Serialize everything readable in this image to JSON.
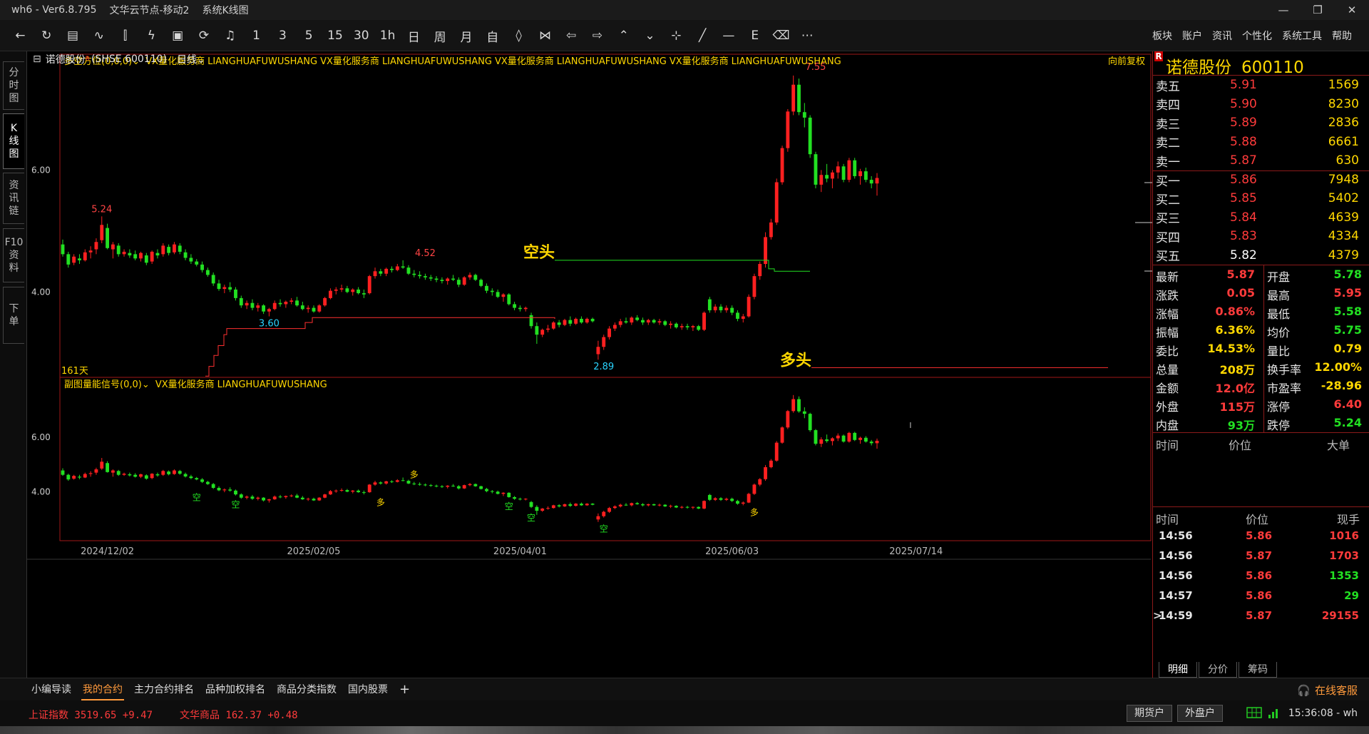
{
  "window": {
    "app": "wh6",
    "version": "Ver6.8.795",
    "server": "文华云节点-移动2",
    "view": "系统K线图",
    "separator": "-"
  },
  "toolbar": {
    "tools": [
      {
        "name": "back-arrow-icon",
        "glyph": "←"
      },
      {
        "name": "refresh-icon",
        "glyph": "↻"
      },
      {
        "name": "quote-list-icon",
        "glyph": "▤"
      },
      {
        "name": "line-chart-icon",
        "glyph": "∿"
      },
      {
        "name": "kline-icon",
        "glyph": "⫿"
      },
      {
        "name": "lightning-icon",
        "glyph": "ϟ"
      },
      {
        "name": "indicator-icon",
        "glyph": "▣"
      },
      {
        "name": "flash-icon",
        "glyph": "⟳"
      },
      {
        "name": "bell-icon",
        "glyph": "♫"
      },
      {
        "name": "period-1m",
        "glyph": "1"
      },
      {
        "name": "period-3m",
        "glyph": "3"
      },
      {
        "name": "period-5m",
        "glyph": "5"
      },
      {
        "name": "period-15m",
        "glyph": "15"
      },
      {
        "name": "period-30m",
        "glyph": "30"
      },
      {
        "name": "period-1h",
        "glyph": "1h"
      },
      {
        "name": "period-day",
        "glyph": "日"
      },
      {
        "name": "period-week",
        "glyph": "周"
      },
      {
        "name": "period-month",
        "glyph": "月"
      },
      {
        "name": "period-custom",
        "glyph": "自"
      },
      {
        "name": "zoom-in-icon",
        "glyph": "◊"
      },
      {
        "name": "zoom-out-icon",
        "glyph": "⋈"
      },
      {
        "name": "move-left-icon",
        "glyph": "⇦"
      },
      {
        "name": "move-right-icon",
        "glyph": "⇨"
      },
      {
        "name": "expand-up-icon",
        "glyph": "⌃"
      },
      {
        "name": "expand-down-icon",
        "glyph": "⌄"
      },
      {
        "name": "crosshair-icon",
        "glyph": "⊹"
      },
      {
        "name": "draw-line-icon",
        "glyph": "╱"
      },
      {
        "name": "horizontal-line-icon",
        "glyph": "—"
      },
      {
        "name": "text-icon",
        "glyph": "E"
      },
      {
        "name": "eraser-icon",
        "glyph": "⌫"
      },
      {
        "name": "more-icon",
        "glyph": "⋯"
      }
    ],
    "menus": [
      "板块",
      "账户",
      "资讯",
      "个性化",
      "系统工具",
      "帮助"
    ]
  },
  "left_tabs": [
    {
      "label": "分\n时\n图",
      "active": false
    },
    {
      "label": "K\n线\n图",
      "active": true
    },
    {
      "label": "资\n讯\n链",
      "active": false
    },
    {
      "label": "F10\n资\n料",
      "active": false
    },
    {
      "label": "下\n单",
      "active": false
    }
  ],
  "stock": {
    "name": "诺德股份",
    "name_superscript": "R",
    "code_label": "(SHSE 600110)",
    "period": "日线",
    "code": "600110"
  },
  "main_chart": {
    "indicator_label": "多空方位(0,0,0)",
    "vendor_items": [
      "VX量化服务商",
      "LIANGHUAFUWUSHANG",
      "VX量化服务商",
      "LIANGHUAFUWUSHANG",
      "VX量化服务商",
      "LIANGHUAFUWUSHANG",
      "VX量化服务商",
      "LIANGHUAFUWUSHANG"
    ],
    "adjust_label": "向前复权",
    "days_label": "161天",
    "annotations": [
      {
        "text": "5.24",
        "color": "#ff4444"
      },
      {
        "text": "4.52",
        "color": "#ff4444"
      },
      {
        "text": "7.55",
        "color": "#ff4444"
      },
      {
        "text": "3.60",
        "color": "#2ad4ff"
      },
      {
        "text": "2.89",
        "color": "#2ad4ff"
      }
    ],
    "bear_label": "空头",
    "bull_label": "多头",
    "ylabels": [
      "6.00",
      "4.00"
    ]
  },
  "sub_chart": {
    "indicator_label": "副图量能信号(0,0)",
    "vendor_items": [
      "VX量化服务商",
      "LIANGHUAFUWUSHANG"
    ],
    "ylabels": [
      "6.00",
      "4.00"
    ],
    "signals": [
      {
        "text": "空",
        "color": "#22e022"
      },
      {
        "text": "空",
        "color": "#22e022"
      },
      {
        "text": "多",
        "color": "#ffd700"
      },
      {
        "text": "多",
        "color": "#ffd700"
      },
      {
        "text": "空",
        "color": "#22e022"
      },
      {
        "text": "空",
        "color": "#22e022"
      },
      {
        "text": "空",
        "color": "#22e022"
      },
      {
        "text": "多",
        "color": "#ffd700"
      }
    ]
  },
  "x_dates": [
    "2024/12/02",
    "2025/02/05",
    "2025/04/01",
    "2025/06/03",
    "2025/07/14"
  ],
  "chart_data": {
    "type": "candlestick",
    "title": "",
    "price_range": [
      2.6,
      7.9
    ],
    "candles": [
      [
        4.78,
        4.86,
        4.58,
        4.62
      ],
      [
        4.62,
        4.66,
        4.4,
        4.45
      ],
      [
        4.48,
        4.62,
        4.44,
        4.58
      ],
      [
        4.55,
        4.62,
        4.46,
        4.52
      ],
      [
        4.52,
        4.7,
        4.5,
        4.65
      ],
      [
        4.65,
        4.75,
        4.55,
        4.68
      ],
      [
        4.7,
        4.88,
        4.62,
        4.82
      ],
      [
        4.85,
        5.24,
        4.8,
        5.1
      ],
      [
        5.05,
        5.12,
        4.7,
        4.72
      ],
      [
        4.7,
        4.82,
        4.55,
        4.78
      ],
      [
        4.76,
        4.8,
        4.58,
        4.62
      ],
      [
        4.62,
        4.7,
        4.58,
        4.66
      ],
      [
        4.64,
        4.7,
        4.56,
        4.6
      ],
      [
        4.62,
        4.68,
        4.52,
        4.55
      ],
      [
        4.55,
        4.66,
        4.5,
        4.64
      ],
      [
        4.6,
        4.64,
        4.44,
        4.48
      ],
      [
        4.5,
        4.68,
        4.46,
        4.66
      ],
      [
        4.64,
        4.7,
        4.55,
        4.6
      ],
      [
        4.62,
        4.8,
        4.58,
        4.76
      ],
      [
        4.74,
        4.78,
        4.6,
        4.64
      ],
      [
        4.65,
        4.82,
        4.62,
        4.78
      ],
      [
        4.76,
        4.8,
        4.62,
        4.66
      ],
      [
        4.65,
        4.7,
        4.52,
        4.56
      ],
      [
        4.56,
        4.62,
        4.46,
        4.5
      ],
      [
        4.5,
        4.54,
        4.42,
        4.45
      ],
      [
        4.45,
        4.5,
        4.32,
        4.36
      ],
      [
        4.36,
        4.4,
        4.25,
        4.28
      ],
      [
        4.28,
        4.32,
        4.1,
        4.14
      ],
      [
        4.14,
        4.2,
        4.02,
        4.05
      ],
      [
        4.05,
        4.12,
        3.98,
        4.08
      ],
      [
        4.08,
        4.16,
        4.0,
        4.04
      ],
      [
        4.04,
        4.08,
        3.86,
        3.9
      ],
      [
        3.9,
        3.94,
        3.74,
        3.78
      ],
      [
        3.78,
        3.86,
        3.72,
        3.82
      ],
      [
        3.82,
        3.88,
        3.7,
        3.74
      ],
      [
        3.74,
        3.82,
        3.68,
        3.78
      ],
      [
        3.78,
        3.8,
        3.64,
        3.68
      ],
      [
        3.68,
        3.74,
        3.6,
        3.72
      ],
      [
        3.72,
        3.86,
        3.7,
        3.82
      ],
      [
        3.82,
        3.88,
        3.76,
        3.8
      ],
      [
        3.8,
        3.86,
        3.74,
        3.84
      ],
      [
        3.84,
        3.9,
        3.8,
        3.86
      ],
      [
        3.86,
        3.92,
        3.76,
        3.78
      ],
      [
        3.78,
        3.84,
        3.7,
        3.72
      ],
      [
        3.72,
        3.78,
        3.66,
        3.74
      ],
      [
        3.74,
        3.78,
        3.66,
        3.68
      ],
      [
        3.68,
        3.8,
        3.66,
        3.78
      ],
      [
        3.78,
        3.92,
        3.76,
        3.9
      ],
      [
        3.9,
        4.06,
        3.88,
        4.02
      ],
      [
        4.02,
        4.08,
        3.96,
        4.04
      ],
      [
        4.04,
        4.12,
        4.0,
        4.06
      ],
      [
        4.06,
        4.1,
        3.98,
        4.0
      ],
      [
        4.0,
        4.06,
        3.94,
        4.04
      ],
      [
        4.04,
        4.08,
        3.96,
        3.98
      ],
      [
        3.98,
        4.04,
        3.9,
        3.96
      ],
      [
        3.98,
        4.28,
        3.96,
        4.26
      ],
      [
        4.26,
        4.4,
        4.22,
        4.34
      ],
      [
        4.34,
        4.38,
        4.26,
        4.3
      ],
      [
        4.3,
        4.4,
        4.26,
        4.38
      ],
      [
        4.38,
        4.42,
        4.32,
        4.36
      ],
      [
        4.36,
        4.46,
        4.34,
        4.42
      ],
      [
        4.42,
        4.52,
        4.38,
        4.4
      ],
      [
        4.4,
        4.44,
        4.28,
        4.3
      ],
      [
        4.3,
        4.36,
        4.24,
        4.28
      ],
      [
        4.28,
        4.34,
        4.22,
        4.26
      ],
      [
        4.26,
        4.3,
        4.2,
        4.24
      ],
      [
        4.24,
        4.28,
        4.18,
        4.22
      ],
      [
        4.22,
        4.26,
        4.16,
        4.2
      ],
      [
        4.2,
        4.24,
        4.14,
        4.18
      ],
      [
        4.18,
        4.24,
        4.12,
        4.22
      ],
      [
        4.22,
        4.28,
        4.18,
        4.2
      ],
      [
        4.2,
        4.24,
        4.08,
        4.12
      ],
      [
        4.12,
        4.26,
        4.1,
        4.24
      ],
      [
        4.24,
        4.32,
        4.2,
        4.28
      ],
      [
        4.28,
        4.3,
        4.18,
        4.2
      ],
      [
        4.2,
        4.22,
        4.08,
        4.1
      ],
      [
        4.1,
        4.14,
        3.98,
        4.02
      ],
      [
        4.02,
        4.06,
        3.94,
        4.0
      ],
      [
        4.0,
        4.04,
        3.9,
        3.92
      ],
      [
        3.92,
        3.98,
        3.84,
        3.96
      ],
      [
        3.96,
        3.98,
        3.78,
        3.8
      ],
      [
        3.8,
        3.84,
        3.7,
        3.74
      ],
      [
        3.74,
        3.78,
        3.68,
        3.72
      ],
      [
        3.72,
        3.76,
        3.68,
        3.74
      ],
      [
        3.62,
        3.66,
        3.4,
        3.44
      ],
      [
        3.44,
        3.5,
        3.15,
        3.3
      ],
      [
        3.3,
        3.4,
        3.26,
        3.38
      ],
      [
        3.38,
        3.46,
        3.34,
        3.4
      ],
      [
        3.4,
        3.52,
        3.38,
        3.5
      ],
      [
        3.5,
        3.54,
        3.42,
        3.46
      ],
      [
        3.46,
        3.56,
        3.44,
        3.54
      ],
      [
        3.54,
        3.6,
        3.44,
        3.48
      ],
      [
        3.48,
        3.58,
        3.46,
        3.56
      ],
      [
        3.56,
        3.6,
        3.48,
        3.5
      ],
      [
        3.5,
        3.58,
        3.48,
        3.56
      ],
      [
        3.56,
        3.58,
        3.5,
        3.52
      ],
      [
        2.98,
        3.2,
        2.89,
        3.1
      ],
      [
        3.1,
        3.3,
        3.05,
        3.26
      ],
      [
        3.26,
        3.44,
        3.22,
        3.4
      ],
      [
        3.4,
        3.5,
        3.36,
        3.46
      ],
      [
        3.46,
        3.56,
        3.42,
        3.52
      ],
      [
        3.52,
        3.58,
        3.48,
        3.5
      ],
      [
        3.5,
        3.6,
        3.46,
        3.58
      ],
      [
        3.58,
        3.62,
        3.52,
        3.54
      ],
      [
        3.54,
        3.58,
        3.46,
        3.5
      ],
      [
        3.5,
        3.56,
        3.46,
        3.54
      ],
      [
        3.54,
        3.56,
        3.48,
        3.5
      ],
      [
        3.5,
        3.56,
        3.46,
        3.52
      ],
      [
        3.52,
        3.54,
        3.44,
        3.46
      ],
      [
        3.46,
        3.52,
        3.4,
        3.48
      ],
      [
        3.48,
        3.5,
        3.4,
        3.42
      ],
      [
        3.42,
        3.48,
        3.38,
        3.44
      ],
      [
        3.44,
        3.48,
        3.38,
        3.42
      ],
      [
        3.42,
        3.46,
        3.36,
        3.44
      ],
      [
        3.44,
        3.46,
        3.36,
        3.38
      ],
      [
        3.38,
        3.68,
        3.36,
        3.66
      ],
      [
        3.88,
        3.92,
        3.66,
        3.7
      ],
      [
        3.7,
        3.8,
        3.66,
        3.76
      ],
      [
        3.76,
        3.8,
        3.66,
        3.7
      ],
      [
        3.7,
        3.78,
        3.66,
        3.74
      ],
      [
        3.74,
        3.78,
        3.62,
        3.66
      ],
      [
        3.66,
        3.7,
        3.52,
        3.56
      ],
      [
        3.56,
        3.64,
        3.5,
        3.6
      ],
      [
        3.6,
        3.96,
        3.58,
        3.92
      ],
      [
        3.92,
        4.3,
        3.88,
        4.26
      ],
      [
        4.26,
        4.5,
        4.2,
        4.46
      ],
      [
        4.46,
        4.98,
        4.4,
        4.9
      ],
      [
        4.9,
        5.2,
        4.86,
        5.14
      ],
      [
        5.14,
        5.86,
        5.1,
        5.8
      ],
      [
        5.8,
        6.4,
        5.76,
        6.36
      ],
      [
        6.36,
        7.0,
        6.3,
        6.96
      ],
      [
        6.96,
        7.55,
        6.9,
        7.4
      ],
      [
        7.4,
        7.5,
        6.9,
        6.95
      ],
      [
        6.95,
        7.1,
        6.7,
        6.86
      ],
      [
        6.86,
        6.9,
        6.2,
        6.26
      ],
      [
        6.26,
        6.3,
        5.7,
        5.76
      ],
      [
        5.76,
        6.0,
        5.64,
        5.92
      ],
      [
        5.92,
        6.1,
        5.8,
        5.86
      ],
      [
        5.86,
        6.0,
        5.7,
        5.96
      ],
      [
        5.96,
        6.14,
        5.86,
        6.06
      ],
      [
        6.06,
        6.1,
        5.8,
        5.84
      ],
      [
        5.84,
        6.2,
        5.8,
        6.16
      ],
      [
        6.16,
        6.2,
        5.86,
        5.9
      ],
      [
        5.9,
        6.02,
        5.76,
        5.98
      ],
      [
        5.98,
        6.04,
        5.8,
        5.84
      ],
      [
        5.84,
        5.9,
        5.7,
        5.78
      ],
      [
        5.78,
        5.95,
        5.58,
        5.87
      ]
    ],
    "bear_line": {
      "label": "空头",
      "value": 4.52
    },
    "bull_line": {
      "label": "多头",
      "value": 2.76
    }
  },
  "quote_panel": {
    "book": [
      {
        "label": "卖五",
        "price": "5.91",
        "vol": "1569"
      },
      {
        "label": "卖四",
        "price": "5.90",
        "vol": "8230"
      },
      {
        "label": "卖三",
        "price": "5.89",
        "vol": "2836"
      },
      {
        "label": "卖二",
        "price": "5.88",
        "vol": "6661"
      },
      {
        "label": "卖一",
        "price": "5.87",
        "vol": "630"
      },
      {
        "label": "买一",
        "price": "5.86",
        "vol": "7948"
      },
      {
        "label": "买二",
        "price": "5.85",
        "vol": "5402"
      },
      {
        "label": "买三",
        "price": "5.84",
        "vol": "4639"
      },
      {
        "label": "买四",
        "price": "5.83",
        "vol": "4334"
      },
      {
        "label": "买五",
        "price": "5.82",
        "vol": "4379"
      }
    ],
    "stats": [
      {
        "l1": "最新",
        "v1": "5.87",
        "c1": "red",
        "l2": "开盘",
        "v2": "5.78",
        "c2": "green"
      },
      {
        "l1": "涨跌",
        "v1": "0.05",
        "c1": "red",
        "l2": "最高",
        "v2": "5.95",
        "c2": "red"
      },
      {
        "l1": "涨幅",
        "v1": "0.86%",
        "c1": "red",
        "l2": "最低",
        "v2": "5.58",
        "c2": "green"
      },
      {
        "l1": "振幅",
        "v1": "6.36%",
        "c1": "yellow",
        "l2": "均价",
        "v2": "5.75",
        "c2": "green"
      },
      {
        "l1": "委比",
        "v1": "14.53%",
        "c1": "yellow",
        "l2": "量比",
        "v2": "0.79",
        "c2": "yellow"
      },
      {
        "l1": "总量",
        "v1": "208万",
        "c1": "yellow",
        "l2": "换手率",
        "v2": "12.00%",
        "c2": "yellow"
      },
      {
        "l1": "金额",
        "v1": "12.0亿",
        "c1": "red",
        "l2": "市盈率",
        "v2": "-28.96",
        "c2": "yellow"
      },
      {
        "l1": "外盘",
        "v1": "115万",
        "c1": "red",
        "l2": "涨停",
        "v2": "6.40",
        "c2": "red"
      },
      {
        "l1": "内盘",
        "v1": "93万",
        "c1": "green",
        "l2": "跌停",
        "v2": "5.24",
        "c2": "green"
      }
    ],
    "big_header": [
      "时间",
      "价位",
      "大单"
    ],
    "tick_header": [
      "时间",
      "价位",
      "现手"
    ],
    "ticks": [
      {
        "time": "14:56",
        "price": "5.86",
        "vol": "1016",
        "vc": "red"
      },
      {
        "time": "14:56",
        "price": "5.87",
        "vol": "1703",
        "vc": "red"
      },
      {
        "time": "14:56",
        "price": "5.86",
        "vol": "1353",
        "vc": "green"
      },
      {
        "time": "14:57",
        "price": "5.86",
        "vol": "29",
        "vc": "green"
      },
      {
        "time": "14:59",
        "price": "5.87",
        "vol": "29155",
        "vc": "red",
        "marker": ">"
      }
    ],
    "bottom_tabs": [
      "明细",
      "分价",
      "筹码"
    ]
  },
  "bottom_tabs": {
    "tabs": [
      "小编导读",
      "我的合约",
      "主力合约排名",
      "品种加权排名",
      "商品分类指数",
      "国内股票"
    ],
    "active": 1,
    "plus": "+",
    "service": "在线客服"
  },
  "status": {
    "index1": "上证指数  3519.65  +9.47",
    "index2": "文华商品  162.37  +0.48",
    "futures_btn": "期货户",
    "external_btn": "外盘户",
    "clock": "15:36:08 - wh"
  },
  "colors": {
    "up": "#ff2020",
    "down": "#22e022",
    "border": "#a01818",
    "yellow_text": "#ffd700"
  }
}
